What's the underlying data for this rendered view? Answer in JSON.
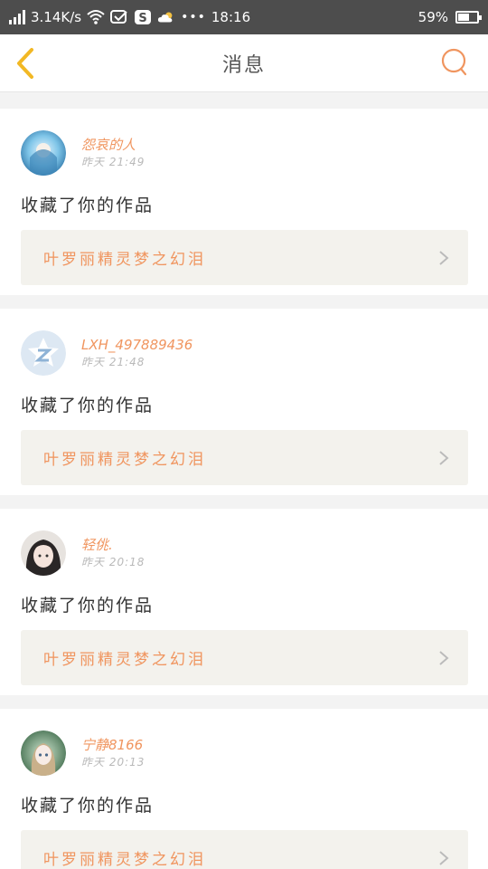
{
  "status_bar": {
    "net_speed": "3.14K/s",
    "time": "18:16",
    "battery": "59%",
    "battery_level": 0.59
  },
  "header": {
    "title": "消息",
    "back_icon": "chevron-left-icon",
    "search_icon": "search-icon"
  },
  "colors": {
    "accent": "#f0955f",
    "back_arrow": "#f2b824",
    "statusbar": "#4d4d4d",
    "work_bg": "#f3f2ed"
  },
  "notifications": [
    {
      "username": "怨哀的人",
      "time": "昨天 21:49",
      "action": "收藏了你的作品",
      "work": "叶罗丽精灵梦之幻泪",
      "avatar": "anime-blue-avatar"
    },
    {
      "username": "LXH_497889436",
      "time": "昨天 21:48",
      "action": "收藏了你的作品",
      "work": "叶罗丽精灵梦之幻泪",
      "avatar": "default-qq-avatar"
    },
    {
      "username": "轻佻.",
      "time": "昨天 20:18",
      "action": "收藏了你的作品",
      "work": "叶罗丽精灵梦之幻泪",
      "avatar": "anime-girl-avatar"
    },
    {
      "username": "宁静8166",
      "time": "昨天 20:13",
      "action": "收藏了你的作品",
      "work": "叶罗丽精灵梦之幻泪",
      "avatar": "doll-avatar"
    }
  ]
}
